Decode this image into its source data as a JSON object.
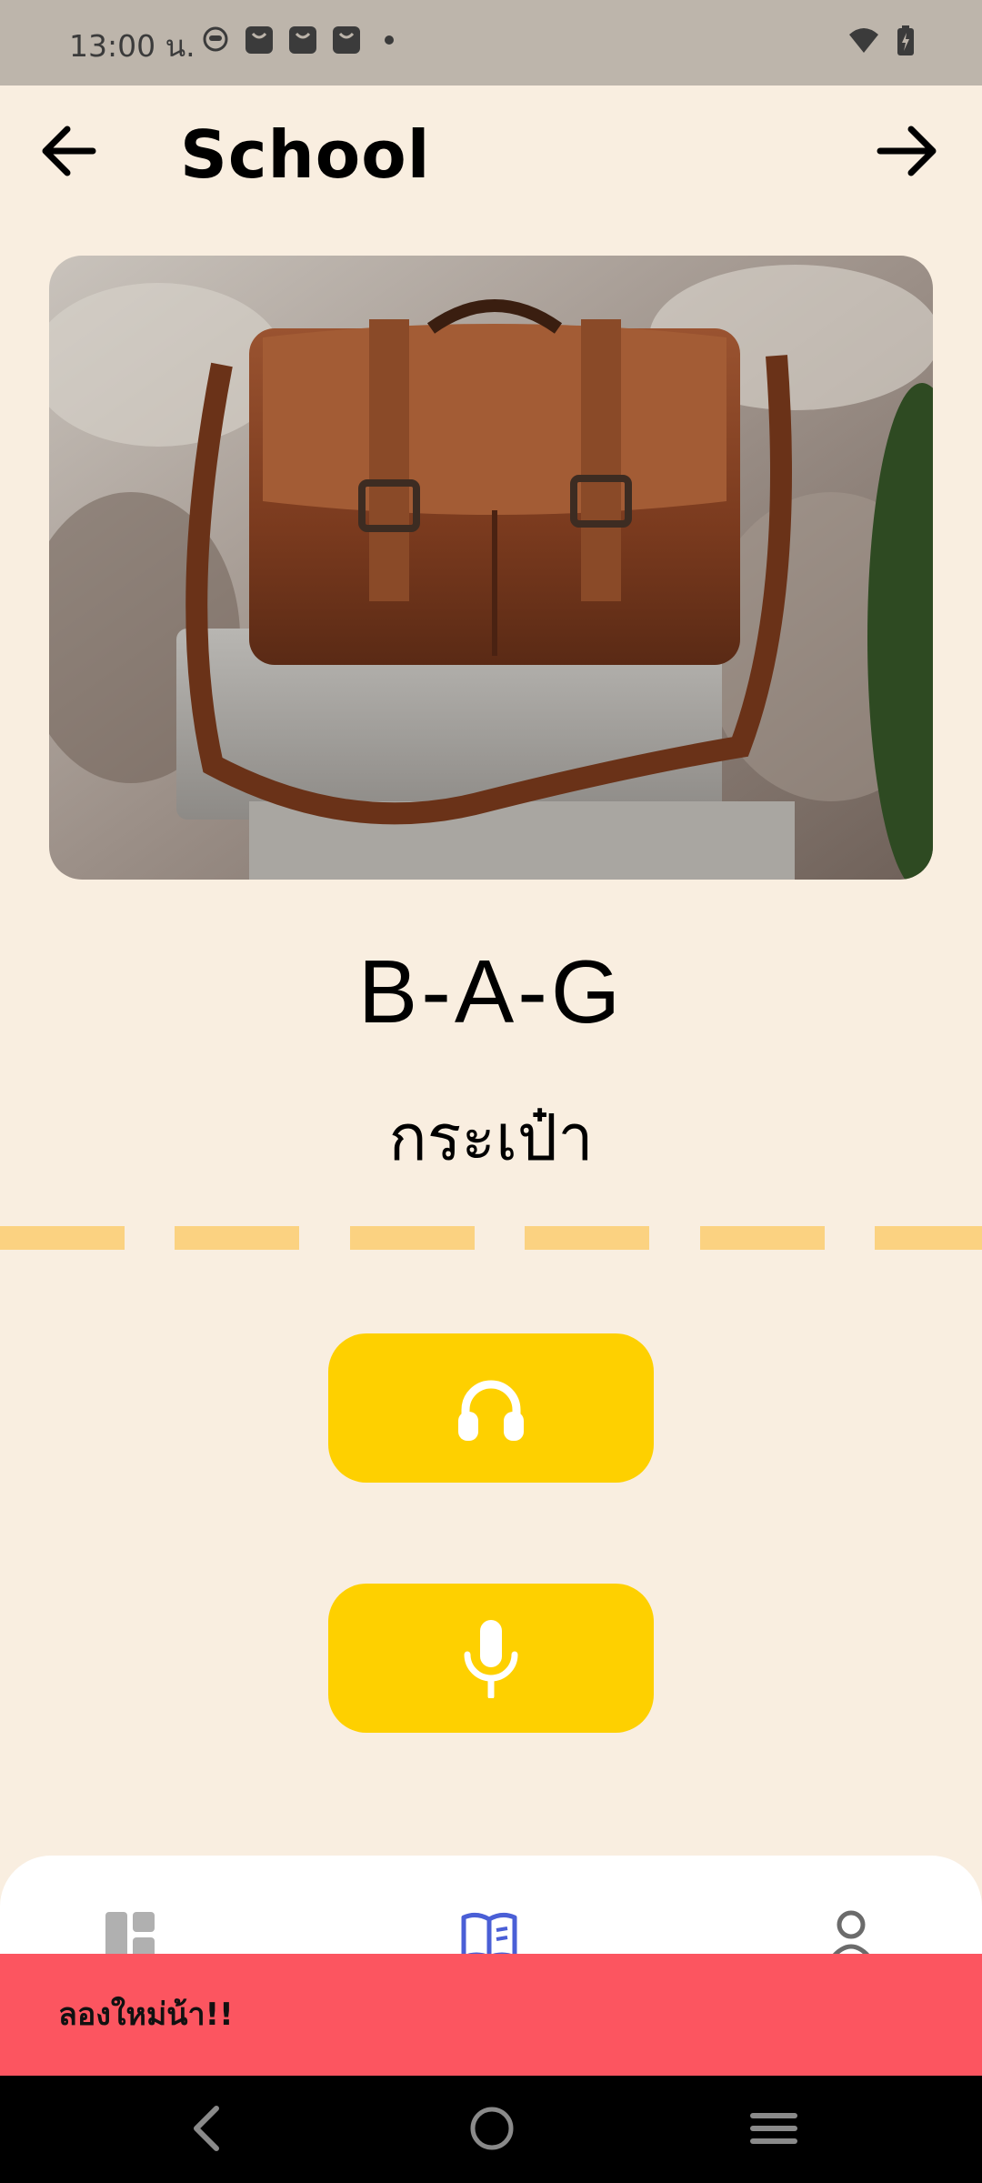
{
  "status_bar": {
    "time": "13:00 น.",
    "icons": [
      "face-icon",
      "bag-icon",
      "bag-icon",
      "bag-icon",
      "dot-icon",
      "wifi-icon",
      "battery-charging-icon"
    ]
  },
  "header": {
    "title": "School",
    "back_icon": "arrow-left-icon",
    "next_icon": "arrow-right-icon"
  },
  "card": {
    "image_subject": "leather-messenger-bag",
    "word": "B-A-G",
    "translation": "กระเป๋า"
  },
  "actions": {
    "listen_icon": "headphones-icon",
    "speak_icon": "microphone-icon"
  },
  "bottom_nav": {
    "items": [
      "dashboard-icon",
      "book-icon",
      "profile-icon"
    ],
    "active_index": 1
  },
  "toast": {
    "message": "ลองใหม่น้า!!"
  },
  "colors": {
    "background": "#f9eee0",
    "accent_yellow": "#fed000",
    "dash": "#fbd281",
    "toast": "#fc5560",
    "status_bar": "#bdb5ab",
    "active_nav": "#4a5fd6"
  }
}
